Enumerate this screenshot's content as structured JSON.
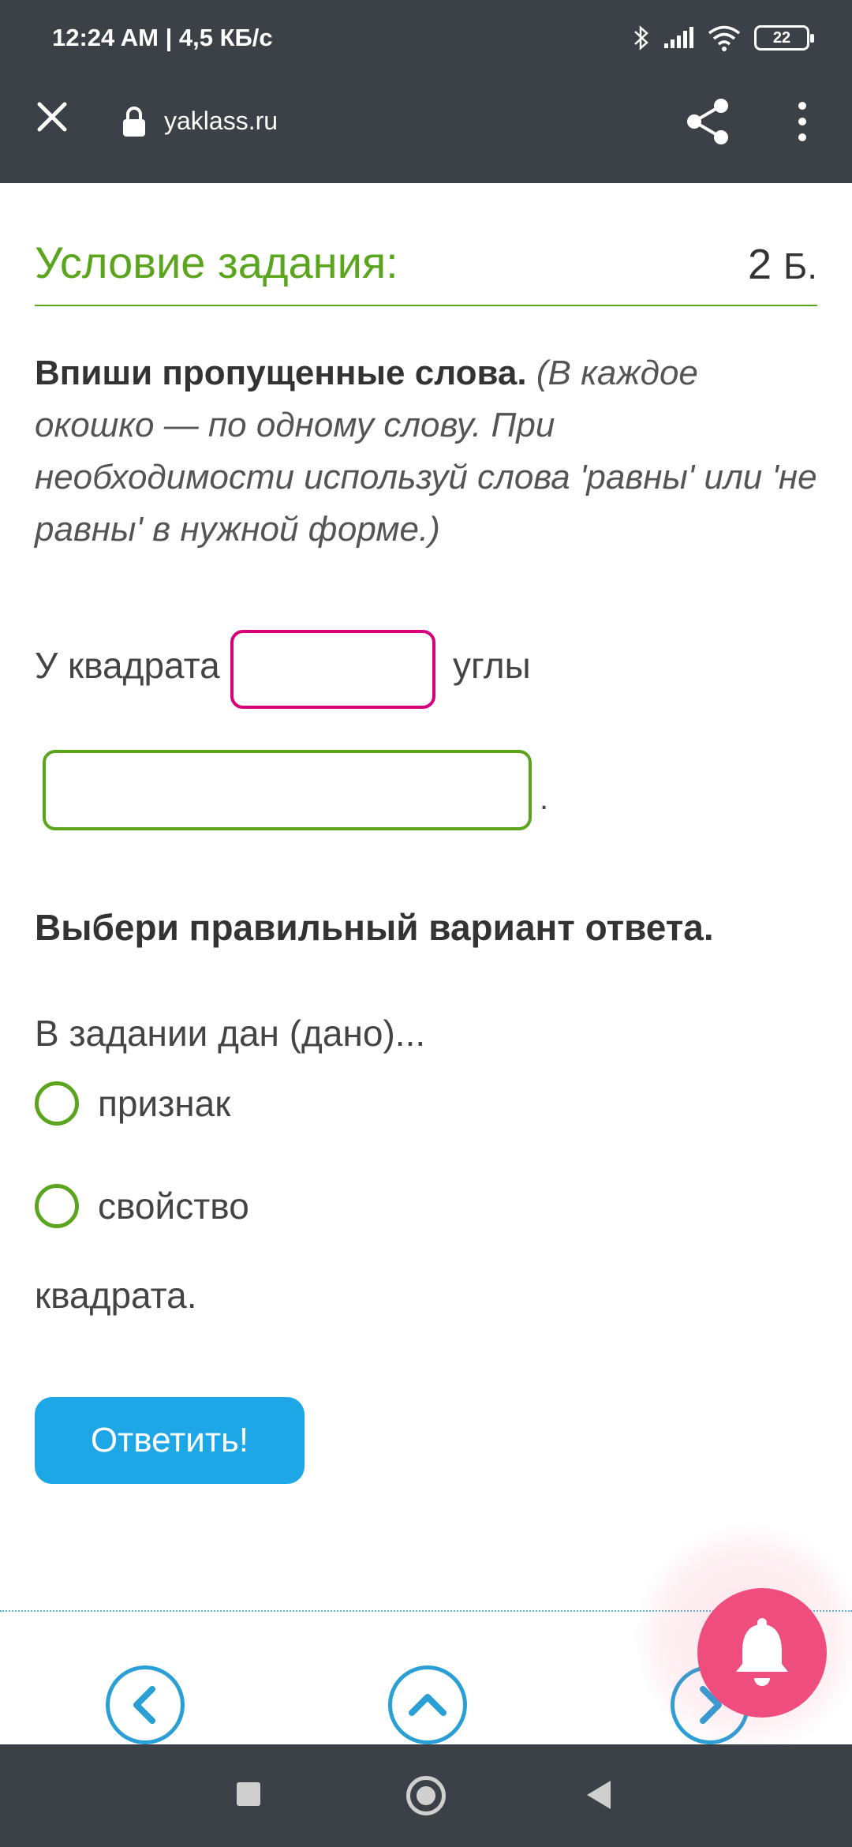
{
  "status_bar": {
    "time": "12:24 AM | 4,5 КБ/с",
    "battery_level": "22",
    "icons": [
      "bluetooth-icon",
      "signal-icon",
      "wifi-icon",
      "battery-icon"
    ]
  },
  "browser": {
    "url": "yaklass.ru",
    "icons": [
      "close-icon",
      "lock-icon",
      "share-icon",
      "more-vert-icon"
    ]
  },
  "task": {
    "title": "Условие задания:",
    "points_value": "2",
    "points_unit": "Б.",
    "instruction_bold": "Впиши пропущенные слова.",
    "instruction_italic": "(В каждое окошко — по одному слову. При необходимости используй слова 'равны' или 'не равны' в нужной форме.)",
    "sentence_start": "У квадрата",
    "sentence_middle": "углы",
    "sentence_end": ".",
    "blank1_value": "",
    "blank2_value": "",
    "choose_heading": "Выбери правильный вариант ответа.",
    "question": "В задании дан (дано)...",
    "options": [
      "признак",
      "свойство"
    ],
    "tail_text": "квадрата.",
    "answer_button": "Ответить!"
  },
  "colors": {
    "accent_green": "#5aa51d",
    "blank_magenta": "#d6007a",
    "button_blue": "#1ea7e6",
    "nav_blue": "#2a9fd6",
    "bell_pink": "#ee4d7d",
    "bar_dark": "#3c4047"
  },
  "nav_icons": [
    "chevron-left-icon",
    "chevron-up-icon",
    "chevron-right-icon",
    "bell-icon"
  ],
  "system_nav": [
    "recents-icon",
    "home-icon",
    "back-icon"
  ]
}
